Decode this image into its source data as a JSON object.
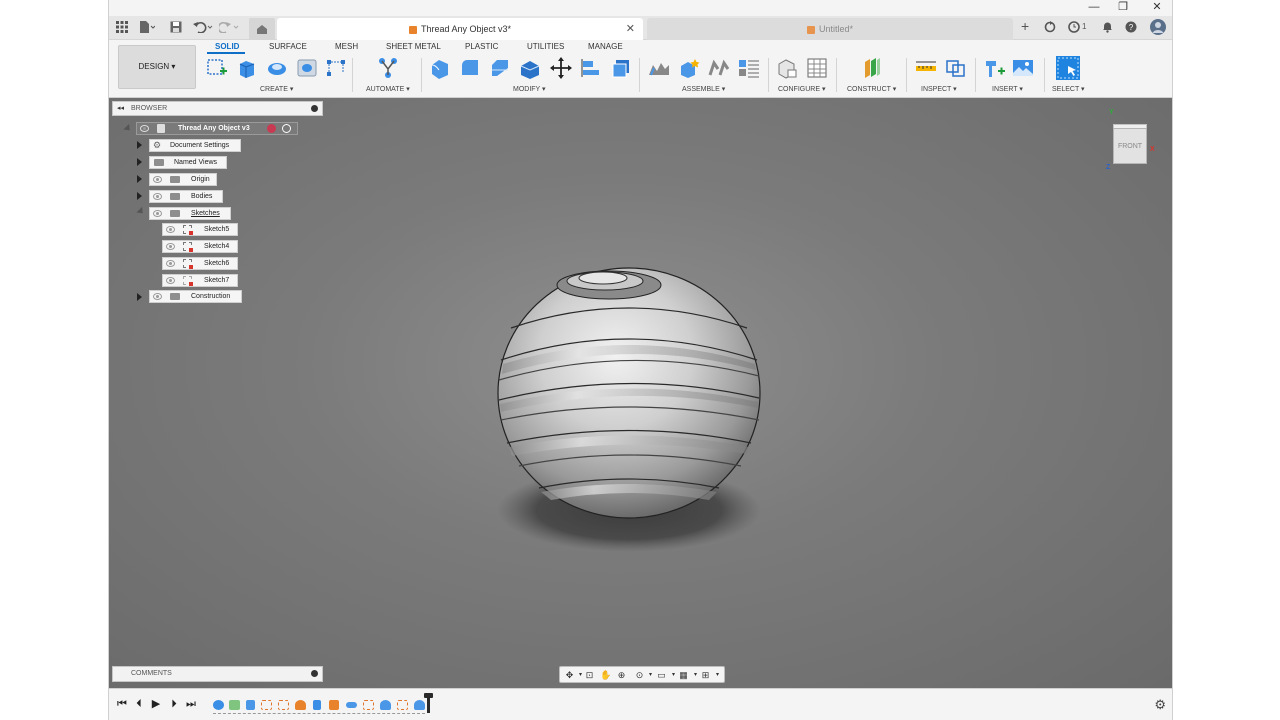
{
  "window": {
    "controls": [
      "—",
      "❐",
      "✕"
    ]
  },
  "tabs": {
    "active_title": "Thread Any Object v3*",
    "inactive_title": "Untitled*",
    "close_glyph": "✕",
    "new_tab_glyph": "+",
    "jobs_count": "1"
  },
  "ribbon": {
    "workspace": "DESIGN",
    "tabs": [
      "SOLID",
      "SURFACE",
      "MESH",
      "SHEET METAL",
      "PLASTIC",
      "UTILITIES",
      "MANAGE"
    ],
    "groups": [
      "CREATE",
      "AUTOMATE",
      "MODIFY",
      "ASSEMBLE",
      "CONFIGURE",
      "CONSTRUCT",
      "INSPECT",
      "INSERT",
      "SELECT"
    ]
  },
  "browser": {
    "title": "BROWSER",
    "root": "Thread Any Object v3",
    "items": [
      "Document Settings",
      "Named Views",
      "Origin",
      "Bodies",
      "Sketches"
    ],
    "sketches": [
      "Sketch5",
      "Sketch4",
      "Sketch6",
      "Sketch7"
    ],
    "construction": "Construction"
  },
  "viewcube": {
    "face": "FRONT",
    "axis_x": "X",
    "axis_y": "Y",
    "axis_z": "Z"
  },
  "comments": {
    "title": "COMMENTS"
  },
  "colors": {
    "accent": "#0f6fc6",
    "orange": "#e8822b",
    "viewport_bg": "#7b7b7b",
    "axis_x": "#d9342b",
    "axis_y": "#2eaa3a",
    "axis_z": "#2f62c7"
  },
  "icons": {
    "timeline": [
      "first-icon",
      "prev-icon",
      "play-icon",
      "next-icon",
      "last-icon"
    ],
    "settings": "gear-icon"
  }
}
